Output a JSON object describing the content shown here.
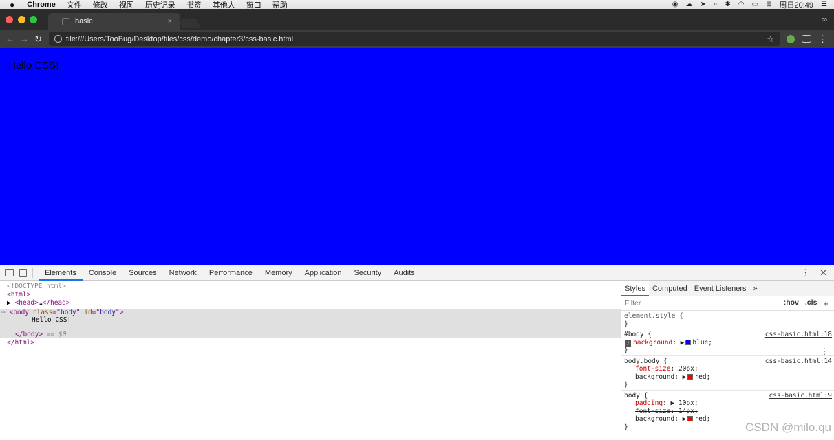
{
  "menubar": {
    "apple": "",
    "menus": [
      "Chrome",
      "文件",
      "修改",
      "视图",
      "历史记录",
      "书签",
      "其他人",
      "窗口",
      "帮助"
    ],
    "clock": "周日20:49"
  },
  "tab": {
    "title": "basic",
    "close": "×"
  },
  "toolbar": {
    "url": "file:///Users/TooBug/Desktop/files/css/demo/chapter3/css-basic.html"
  },
  "page": {
    "text": "Hello CSS!",
    "background": "#0000ff"
  },
  "devtools": {
    "tabs": [
      "Elements",
      "Console",
      "Sources",
      "Network",
      "Performance",
      "Memory",
      "Application",
      "Security",
      "Audits"
    ],
    "active_tab": "Elements",
    "dom": {
      "doctype": "<!DOCTYPE html>",
      "html_open": "html",
      "head": "head",
      "head_ellipsis": "…",
      "body_tag": "body",
      "class_attr": "class",
      "class_val": "body",
      "id_attr": "id",
      "id_val": "body",
      "body_text": "Hello CSS!",
      "body_close": "/body",
      "dollar0": "== $0",
      "html_close": "/html"
    },
    "styles": {
      "tabs": [
        "Styles",
        "Computed",
        "Event Listeners"
      ],
      "more": "»",
      "filter_placeholder": "Filter",
      "hov": ":hov",
      "cls": ".cls",
      "rules": [
        {
          "selector": "element.style {",
          "source": "",
          "props": []
        },
        {
          "selector": "#body {",
          "source": "css-basic.html:18",
          "props": [
            {
              "name": "background",
              "value": "blue",
              "swatch": "#0000ff",
              "struck": false,
              "checked": true
            }
          ]
        },
        {
          "selector": "body.body {",
          "source": "css-basic.html:14",
          "props": [
            {
              "name": "font-size",
              "value": "20px",
              "struck": false
            },
            {
              "name": "background",
              "value": "red",
              "swatch": "#ff0000",
              "struck": true
            }
          ]
        },
        {
          "selector": "body {",
          "source": "css-basic.html:9",
          "props": [
            {
              "name": "padding",
              "value": "10px",
              "struck": false,
              "arrow": true
            },
            {
              "name": "font-size",
              "value": "14px",
              "struck": true
            },
            {
              "name": "background",
              "value": "red",
              "swatch": "#ff0000",
              "struck": true
            }
          ]
        }
      ]
    }
  },
  "watermark": "CSDN @milo.qu"
}
